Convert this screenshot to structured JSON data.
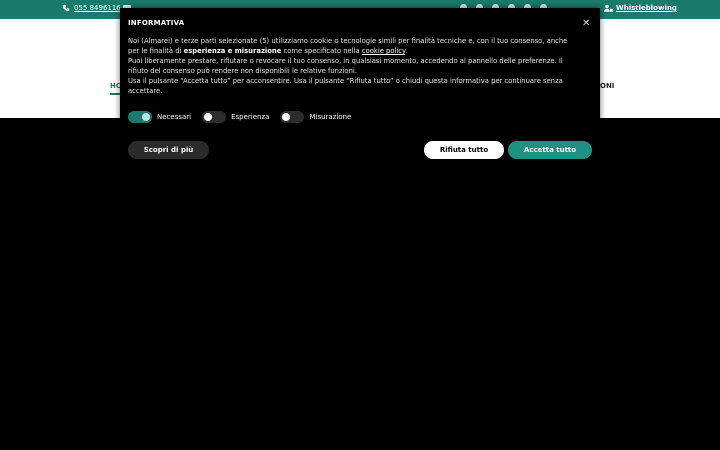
{
  "topbar": {
    "phone": "055 8496116",
    "whistleblowing": "Whistleblowing",
    "social_icons": [
      "facebook-icon",
      "instagram-icon",
      "linkedin-icon",
      "telegram-icon",
      "pinterest-icon",
      "youtube-icon"
    ]
  },
  "nav": {
    "home": "HO",
    "right_fragment": "ONI"
  },
  "cookie": {
    "title": "INFORMATIVA",
    "p1_a": "Noi (Almarei) e terze parti selezionate (5) utilizziamo cookie o tecnologie simili per finalità tecniche e, con il tuo consenso, anche per le finalità di ",
    "p1_bold": "esperienza e misurazione",
    "p1_b": " come specificato nella ",
    "p1_link": "cookie policy",
    "p1_c": ".",
    "p2": "Puoi liberamente prestare, rifiutare o revocare il tuo consenso, in qualsiasi momento, accedendo al pannello delle preferenze. Il rifiuto del consenso può rendere non disponibili le relative funzioni.",
    "p3": "Usa il pulsante “Accetta tutto” per acconsentire. Usa il pulsante “Rifiuta tutto” o chiudi questa informativa per continuare senza accettare.",
    "toggles": [
      {
        "label": "Necessari",
        "on": true
      },
      {
        "label": "Esperienza",
        "on": false
      },
      {
        "label": "Misurazione",
        "on": false
      }
    ],
    "btn_more": "Scopri di più",
    "btn_reject": "Rifiuta tutto",
    "btn_accept": "Accetta tutto"
  },
  "colors": {
    "brand": "#1a7a6c",
    "accept": "#1f9183"
  }
}
